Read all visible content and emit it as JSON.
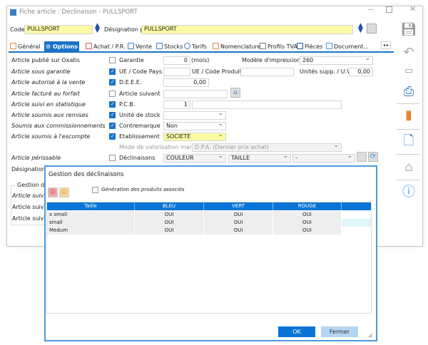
{
  "window": {
    "title": "Fiche article : Déclinaison - PULLSPORT"
  },
  "header": {
    "code_label": "Code",
    "code_value": "PULLSPORT",
    "designation_label": "Désignation pr",
    "designation_value": "PULLSPORT"
  },
  "tabs": [
    "Général",
    "Options",
    "Achat / P.R.",
    "Vente",
    "Stocks",
    "Tarifs",
    "Nomenclature",
    "Profils TVA",
    "Pièces",
    "Document..."
  ],
  "active_tab": "Options",
  "left_options": [
    "Article publié sur Oxatis",
    "Article sous garantie",
    "Article autorisé à la vente",
    "Article facturé au forfait",
    "Article suivi en statistique",
    "Article soumis aux remises",
    "Soumis aux commissionnements",
    "Article soumis à l'escompte",
    "Article périssable",
    "Désignation s"
  ],
  "fields": {
    "garantie": {
      "label": "Garantie",
      "value": "0",
      "unit": "(mois)",
      "checked": false
    },
    "modele": {
      "label": "Modèle d'impression",
      "value": "260"
    },
    "ue_pays": {
      "label": "UE / Code Pays",
      "value": "",
      "checked": true
    },
    "ue_produit": {
      "label": "UE / Code Produit",
      "value": ""
    },
    "unites_supp": {
      "label": "Unités supp. / U.V.",
      "value": "0,00"
    },
    "deee": {
      "label": "D.E.E.E.",
      "value": "0,00",
      "checked": true
    },
    "article_suivant": {
      "label": "Article suivant",
      "value": "",
      "checked": false
    },
    "pcb": {
      "label": "P.C.B.",
      "value": "1",
      "checked": true
    },
    "unite_stock": {
      "label": "Unité de stock",
      "value": "",
      "checked": true
    },
    "contremarque": {
      "label": "Contremarque",
      "value": "Non",
      "checked": true
    },
    "etablissement": {
      "label": "Etablissement",
      "value": "SOCIETE",
      "checked": true
    },
    "mode_valorisation": {
      "label": "Mode de valorisation marge",
      "value": "D.P.A. (Dernier prix achat)"
    },
    "declinaisons": {
      "label": "Déclinaisons",
      "checked": false,
      "values": [
        "COULEUR",
        "TAILLE",
        "-"
      ]
    }
  },
  "gestion": {
    "legend": "Gestion des",
    "rows": [
      "Article suivi en",
      "Article suivi e",
      "Article suivi e"
    ]
  },
  "dialog": {
    "title": "Gestion des déclinaisons",
    "generation_label": "Génération des produits associés",
    "columns": [
      "Taille",
      "BLEU",
      "VERT",
      "ROUGE"
    ],
    "rows": [
      [
        "x small",
        "OUI",
        "OUI",
        "OUI"
      ],
      [
        "small",
        "OUI",
        "OUI",
        "OUI"
      ],
      [
        "Medum",
        "OUI",
        "OUI",
        "OUI"
      ]
    ],
    "ok": "OK",
    "close": "Fermer"
  },
  "colors": {
    "accent": "#1a73c9",
    "highlight": "#fdfaa6"
  }
}
